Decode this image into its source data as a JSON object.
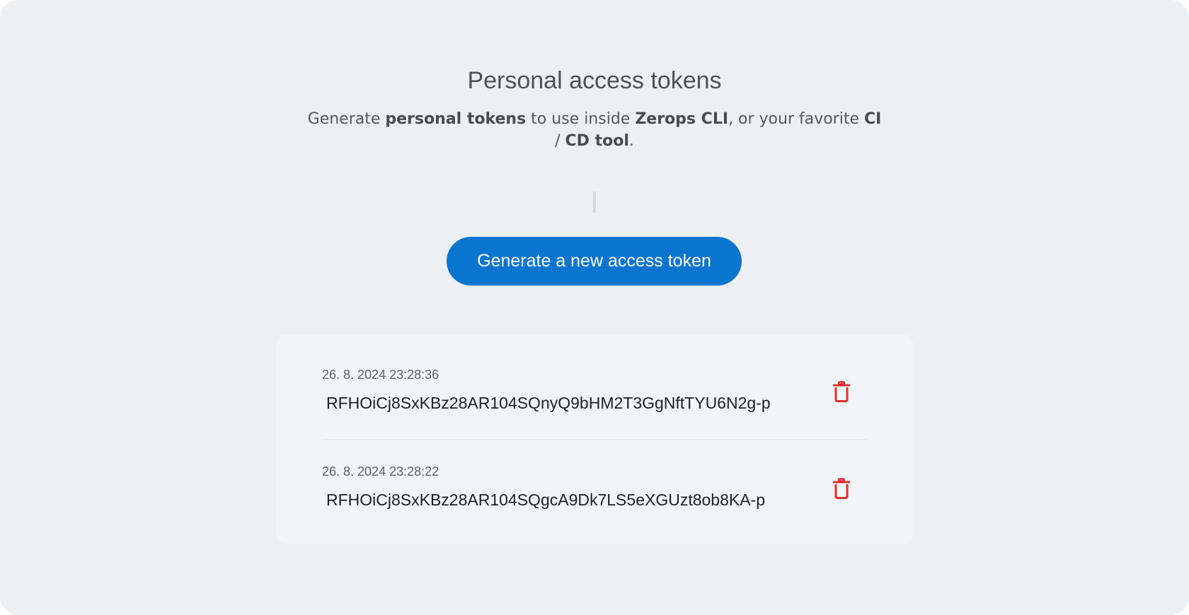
{
  "page": {
    "title": "Personal access tokens",
    "subtitle": {
      "part1": "Generate ",
      "bold1": "personal tokens",
      "part2": " to use inside ",
      "bold2": "Zerops CLI",
      "part3": ", or your favorite ",
      "bold3": "CI",
      "part4": " / ",
      "bold4": "CD tool",
      "part5": "."
    }
  },
  "actions": {
    "generate_label": "Generate a new access token"
  },
  "tokens": [
    {
      "date": "26. 8. 2024 23:28:36",
      "value": "RFHOiCj8SxKBz28AR104SQnyQ9bHM2T3GgNftTYU6N2g-p",
      "delete_icon": "trash-icon"
    },
    {
      "date": "26. 8. 2024 23:28:22",
      "value": "RFHOiCj8SxKBz28AR104SQgcA9Dk7LS5eXGUzt8ob8KA-p",
      "delete_icon": "trash-icon"
    }
  ],
  "colors": {
    "background": "#eceff4",
    "card": "#f1f4f8",
    "accent": "#0a75cf",
    "danger": "#e03131"
  }
}
